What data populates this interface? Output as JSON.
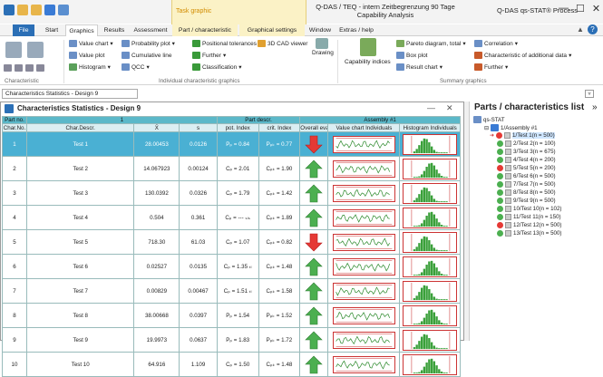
{
  "window": {
    "title_line1": "Q-DAS / TEQ - intern Zeitbegrenzung 90 Tage",
    "title_line2": "Capability Analysis",
    "app_name": "Q-DAS qs-STAT® Process",
    "context_tab_header": "Task graphic",
    "minimize": "—",
    "maximize": "☐",
    "close": "✕"
  },
  "tabs": [
    "File",
    "Start",
    "Graphics",
    "Results",
    "Assessment",
    "Part / characteristic",
    "Graphical settings",
    "Window",
    "Extras / help"
  ],
  "ribbon": {
    "characteristic_group": "Characteristic",
    "individual_group": "Individual characteristic graphics",
    "summary_group": "Summary graphics",
    "value_chart": "Value chart",
    "value_plot": "Value plot",
    "histogram": "Histogram",
    "probability_plot": "Probability plot",
    "cumulative_line": "Cumulative line",
    "qcc": "QCC",
    "positional_tolerances": "Positional tolerances",
    "further1": "Further",
    "classification": "Classification",
    "cad_viewer": "3D CAD viewer",
    "drawing": "Drawing",
    "capability_indices": "Capability indices",
    "pareto": "Pareto diagram, total",
    "box_plot": "Box plot",
    "result_chart": "Result chart",
    "correlation": "Correlation",
    "char_additional": "Characteristic of additional data",
    "further2": "Further"
  },
  "doc_tab": "Characteristics Statistics - Design 9",
  "child": {
    "title": "Characteristics Statistics - Design 9",
    "minimize": "—",
    "close": "✕"
  },
  "table": {
    "part_no_label": "Part no.",
    "part_no_value": "1",
    "part_descr_label": "Part descr.",
    "part_descr_value": "Assembly #1",
    "headers": [
      "Char.No.",
      "Char.Descr.",
      "X̄",
      "s",
      "pot. Index",
      "crit. Index",
      "Overall evaluation",
      "Value chart Individuals",
      "Histogram Individuals"
    ],
    "rows": [
      {
        "no": "1",
        "descr": "Test 1",
        "xbar": "28.00453",
        "s": "0.0126",
        "pot": "Pₚ = 0.84",
        "crit": "Pₚₖ = 0.77",
        "eval": "down"
      },
      {
        "no": "2",
        "descr": "Test 2",
        "xbar": "14.067923",
        "s": "0.00124",
        "pot": "Cₚ = 2.01",
        "crit": "Cₚₖ = 1.90",
        "eval": "up"
      },
      {
        "no": "3",
        "descr": "Test 3",
        "xbar": "130.0392",
        "s": "0.0326",
        "pot": "Cₚ = 1.79",
        "crit": "Cₚₖ = 1.42",
        "eval": "up"
      },
      {
        "no": "4",
        "descr": "Test 4",
        "xbar": "0.504",
        "s": "0.361",
        "pot": "Cₚ = --- ₛₗₛ",
        "crit": "Cₚₖ = 1.89",
        "eval": "up"
      },
      {
        "no": "5",
        "descr": "Test 5",
        "xbar": "718.30",
        "s": "61.03",
        "pot": "Cₚ = 1.07",
        "crit": "Cₚₖ = 0.82",
        "eval": "down"
      },
      {
        "no": "6",
        "descr": "Test 6",
        "xbar": "0.02527",
        "s": "0.0135",
        "pot": "Cₚ = 1.35 ₜₗ",
        "crit": "Cₚₖ = 1.48",
        "eval": "up"
      },
      {
        "no": "7",
        "descr": "Test 7",
        "xbar": "0.00829",
        "s": "0.00467",
        "pot": "Cₚ = 1.51 ₜₗ",
        "crit": "Cₚₖ = 1.58",
        "eval": "up"
      },
      {
        "no": "8",
        "descr": "Test 8",
        "xbar": "38.00668",
        "s": "0.0397",
        "pot": "Pₚ = 1.54",
        "crit": "Pₚₖ = 1.52",
        "eval": "up"
      },
      {
        "no": "9",
        "descr": "Test 9",
        "xbar": "19.9973",
        "s": "0.0637",
        "pot": "Pₚ = 1.83",
        "crit": "Pₚₖ = 1.72",
        "eval": "up"
      },
      {
        "no": "10",
        "descr": "Test 10",
        "xbar": "64.916",
        "s": "1.109",
        "pot": "Cₚ = 1.50",
        "crit": "Cₚₖ = 1.48",
        "eval": "up"
      }
    ]
  },
  "panel": {
    "title": "Parts / characteristics list",
    "collapse": "»",
    "root": "qs-STAT",
    "assembly": "1/Assembly #1",
    "items": [
      {
        "label": "1/Test 1(n = 500)",
        "status": "red"
      },
      {
        "label": "2/Test 2(n = 100)",
        "status": "green"
      },
      {
        "label": "3/Test 3(n = 675)",
        "status": "green"
      },
      {
        "label": "4/Test 4(n = 200)",
        "status": "green"
      },
      {
        "label": "5/Test 5(n = 200)",
        "status": "red"
      },
      {
        "label": "6/Test 6(n = 500)",
        "status": "green"
      },
      {
        "label": "7/Test 7(n = 500)",
        "status": "green"
      },
      {
        "label": "8/Test 8(n = 500)",
        "status": "green"
      },
      {
        "label": "9/Test 9(n = 500)",
        "status": "green"
      },
      {
        "label": "10/Test 10(n = 102)",
        "status": "green"
      },
      {
        "label": "11/Test 11(n = 150)",
        "status": "green"
      },
      {
        "label": "12/Test 12(n = 500)",
        "status": "red"
      },
      {
        "label": "13/Test 13(n = 500)",
        "status": "green"
      }
    ]
  },
  "colors": {
    "accent": "#2b6fb6",
    "header": "#5bb8c9",
    "selected": "#4ab0d3",
    "good": "#4caf50",
    "bad": "#e53935"
  }
}
